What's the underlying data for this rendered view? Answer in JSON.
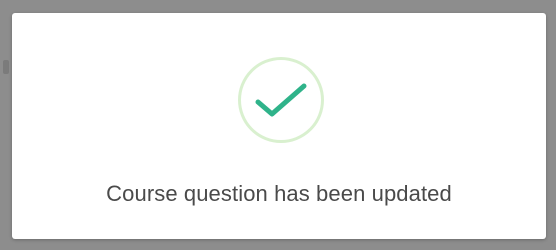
{
  "dialog": {
    "icon": "check-icon",
    "message": "Course question has been updated",
    "colors": {
      "check": "#2fb38a",
      "ring": "#d9f0cf",
      "text": "#4a4a4a",
      "overlay": "#8d8d8d"
    }
  }
}
